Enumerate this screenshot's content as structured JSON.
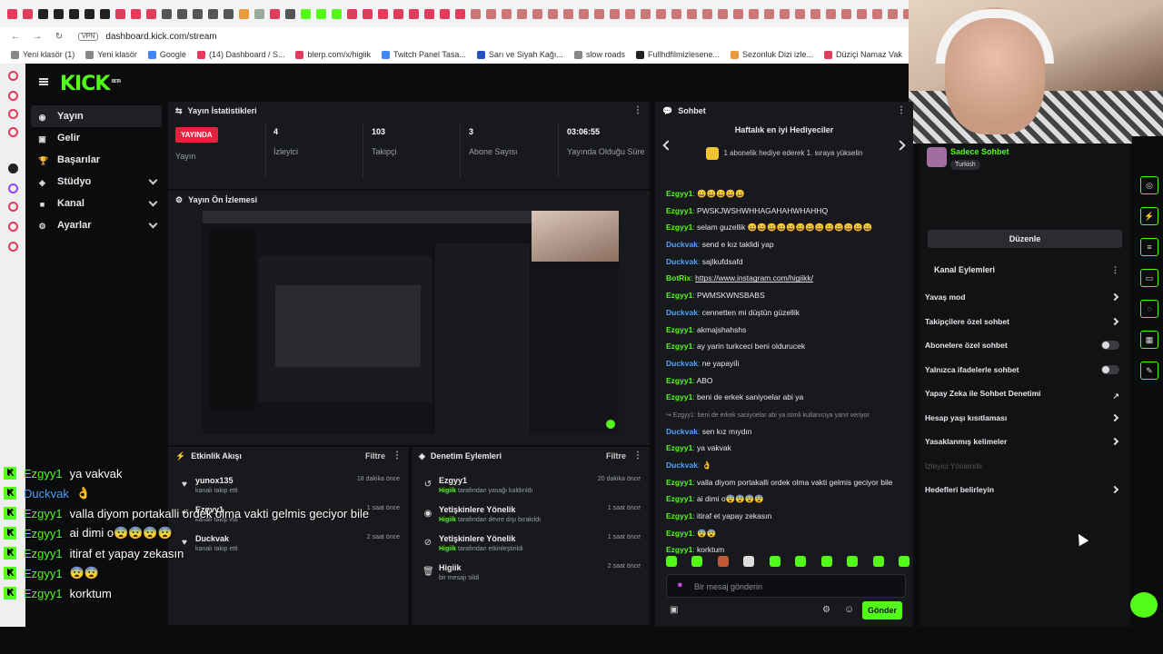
{
  "browser": {
    "url": "dashboard.kick.com/stream",
    "vpn": "VPN",
    "bookmarks": [
      "Yeni klasör (1)",
      "Yeni klasör",
      "Google",
      "(14) Dashboard / S...",
      "blerp.com/x/higiik",
      "Twitch Panel Tasa...",
      "Sarı ve Siyah Kağı...",
      "slow roads",
      "Fullhdfilmizlesene...",
      "Sezonluk Dizi izle...",
      "Düziçi Namaz Vak"
    ]
  },
  "logo": {
    "text": "KICK",
    "beta": "BETA"
  },
  "nav": [
    {
      "label": "Yayın",
      "icon": "stream-icon",
      "active": true
    },
    {
      "label": "Gelir",
      "icon": "wallet-icon"
    },
    {
      "label": "Başarılar",
      "icon": "trophy-icon"
    },
    {
      "label": "Stüdyo",
      "icon": "studio-icon",
      "expandable": true
    },
    {
      "label": "Kanal",
      "icon": "channel-icon",
      "expandable": true
    },
    {
      "label": "Ayarlar",
      "icon": "settings-icon",
      "expandable": true
    }
  ],
  "stats": {
    "title": "Yayın İstatistikleri",
    "live": "YAYINDA",
    "status_label": "Yayın",
    "items": [
      {
        "value": "4",
        "label": "İzleyici"
      },
      {
        "value": "103",
        "label": "Takipçi"
      },
      {
        "value": "3",
        "label": "Abone Sayısı"
      },
      {
        "value": "03:06:55",
        "label": "Yayında Olduğu Süre"
      }
    ]
  },
  "preview": {
    "title": "Yayın Ön İzlemesi"
  },
  "events": {
    "title": "Etkinlik Akışı",
    "filter": "Filtre",
    "items": [
      {
        "name": "yunox135",
        "sub": "kanalı takip etti",
        "time": "18 dakika önce"
      },
      {
        "name": "Ezgyy1",
        "sub": "kanalı takip etti",
        "time": "1 saat önce"
      },
      {
        "name": "Duckvak",
        "sub": "kanalı takip etti",
        "time": "2 saat önce"
      }
    ]
  },
  "moderation": {
    "title": "Denetim Eylemleri",
    "filter": "Filtre",
    "items": [
      {
        "name": "Ezgyy1",
        "actor": "Higiik",
        "sub": " tarafından yasağı kaldırıldı",
        "time": "20 dakika önce"
      },
      {
        "name": "Yetişkinlere Yönelik",
        "actor": "Higiik",
        "sub": " tarafından devre dışı bırakıldı",
        "time": "1 saat önce"
      },
      {
        "name": "Yetişkinlere Yönelik",
        "actor": "Higiik",
        "sub": " tarafından etkinleştirildi",
        "time": "1 saat önce"
      },
      {
        "name": "Higiik",
        "actor": "",
        "sub": "bir mesajı sildi",
        "time": "2 saat önce"
      }
    ]
  },
  "chat": {
    "title": "Sohbet",
    "gift_title": "Haftalık en iyi Hediyeciler",
    "gift_text": "1 abonelik hediye ederek 1. sıraya yükselin",
    "placeholder": "Bir mesaj gönderin",
    "send": "Gönder",
    "messages": [
      {
        "user": "Ezgyy1",
        "color": "#53fc18",
        "text": "😀😀😀😀😀"
      },
      {
        "user": "Ezgyy1",
        "color": "#53fc18",
        "text": "PWSKJWSHWHHAGAHAHWHAHHQ"
      },
      {
        "user": "Ezgyy1",
        "color": "#53fc18",
        "text": "selam guzellik 😀😀😀😀😀😀😀😀😀😀😀😀😀"
      },
      {
        "user": "Duckvak",
        "color": "#4fa3ff",
        "text": "send e kız taklidi yap"
      },
      {
        "user": "Duckvak",
        "color": "#4fa3ff",
        "text": "sajlkufdsafd"
      },
      {
        "user": "BotRix",
        "color": "#53fc18",
        "text": "https://www.instagram.com/higiikk/"
      },
      {
        "user": "Ezgyy1",
        "color": "#53fc18",
        "text": "PWMSKWNSBABS"
      },
      {
        "user": "Duckvak",
        "color": "#4fa3ff",
        "text": "cennetten mi düştün güzellik"
      },
      {
        "user": "Ezgyy1",
        "color": "#53fc18",
        "text": "akmajshahshs"
      },
      {
        "user": "Ezgyy1",
        "color": "#53fc18",
        "text": "ay yarin turkceci beni oldurucek"
      },
      {
        "user": "Duckvak",
        "color": "#4fa3ff",
        "text": "ne yapayiİi"
      },
      {
        "user": "Ezgyy1",
        "color": "#53fc18",
        "text": "ABO"
      },
      {
        "user": "Ezgyy1",
        "color": "#53fc18",
        "text": "beni de erkek saniyoelar abi ya"
      },
      {
        "user": "",
        "color": "#8a8f96",
        "text": "↪ Ezgyy1: beni de erkek saniyoelar abi ya isimli kullanıcıya yanıt veriyor"
      },
      {
        "user": "Duckvak",
        "color": "#4fa3ff",
        "text": "sen kız mıydın"
      },
      {
        "user": "Ezgyy1",
        "color": "#53fc18",
        "text": "ya vakvak"
      },
      {
        "user": "Duckvak",
        "color": "#4fa3ff",
        "text": "👌"
      },
      {
        "user": "Ezgyy1",
        "color": "#53fc18",
        "text": "valla diyom portakalli ordek olma vakti gelmis geciyor bile"
      },
      {
        "user": "Ezgyy1",
        "color": "#53fc18",
        "text": "ai dimi o😨😨😨😨"
      },
      {
        "user": "Ezgyy1",
        "color": "#53fc18",
        "text": "itiraf et yapay zekasın"
      },
      {
        "user": "Ezgyy1",
        "color": "#53fc18",
        "text": "😨😨"
      },
      {
        "user": "Ezgyy1",
        "color": "#53fc18",
        "text": "korktum"
      }
    ]
  },
  "rightpanel": {
    "only_chat": "Sadece Sohbet",
    "lang": "Turkish",
    "edit": "Düzenle",
    "actions_title": "Kanal Eylemleri",
    "actions": [
      {
        "label": "Yavaş mod",
        "kind": "arrow"
      },
      {
        "label": "Takipçilere özel sohbet",
        "kind": "arrow"
      },
      {
        "label": "Abonelere özel sohbet",
        "kind": "toggle"
      },
      {
        "label": "Yalnızca ifadelerle sohbet",
        "kind": "toggle"
      },
      {
        "label": "Yapay Zeka ile Sohbet Denetimi",
        "kind": "external"
      },
      {
        "label": "Hesap yaşı kısıtlaması",
        "kind": "arrow"
      },
      {
        "label": "Yasaklanmış kelimeler",
        "kind": "arrow"
      },
      {
        "label": "İzleyici Yönlendir",
        "kind": "disabled"
      },
      {
        "label": "Hedefleri belirleyin",
        "kind": "arrow"
      }
    ]
  },
  "overlay": [
    {
      "user": "Ezgyy1",
      "color": "#53fc18",
      "text": "ya vakvak"
    },
    {
      "user": "Duckvak",
      "color": "#4fa3ff",
      "text": "👌"
    },
    {
      "user": "Ezgyy1",
      "color": "#53fc18",
      "text": "valla diyom portakalli ördek olma vakti gelmis geciyor bile"
    },
    {
      "user": "Ezgyy1",
      "color": "#53fc18",
      "text": "ai dimi o😨😨😨😨"
    },
    {
      "user": "Ezgyy1",
      "color": "#53fc18",
      "text": "itiraf et yapay zekasın"
    },
    {
      "user": "Ezgyy1",
      "color": "#53fc18",
      "text": "😨😨"
    },
    {
      "user": "Ezgyy1",
      "color": "#53fc18",
      "text": "korktum"
    }
  ],
  "colors": {
    "accent": "#53fc18",
    "live": "#e5233e",
    "panel": "#18191c",
    "bg": "#0b0c0e"
  }
}
